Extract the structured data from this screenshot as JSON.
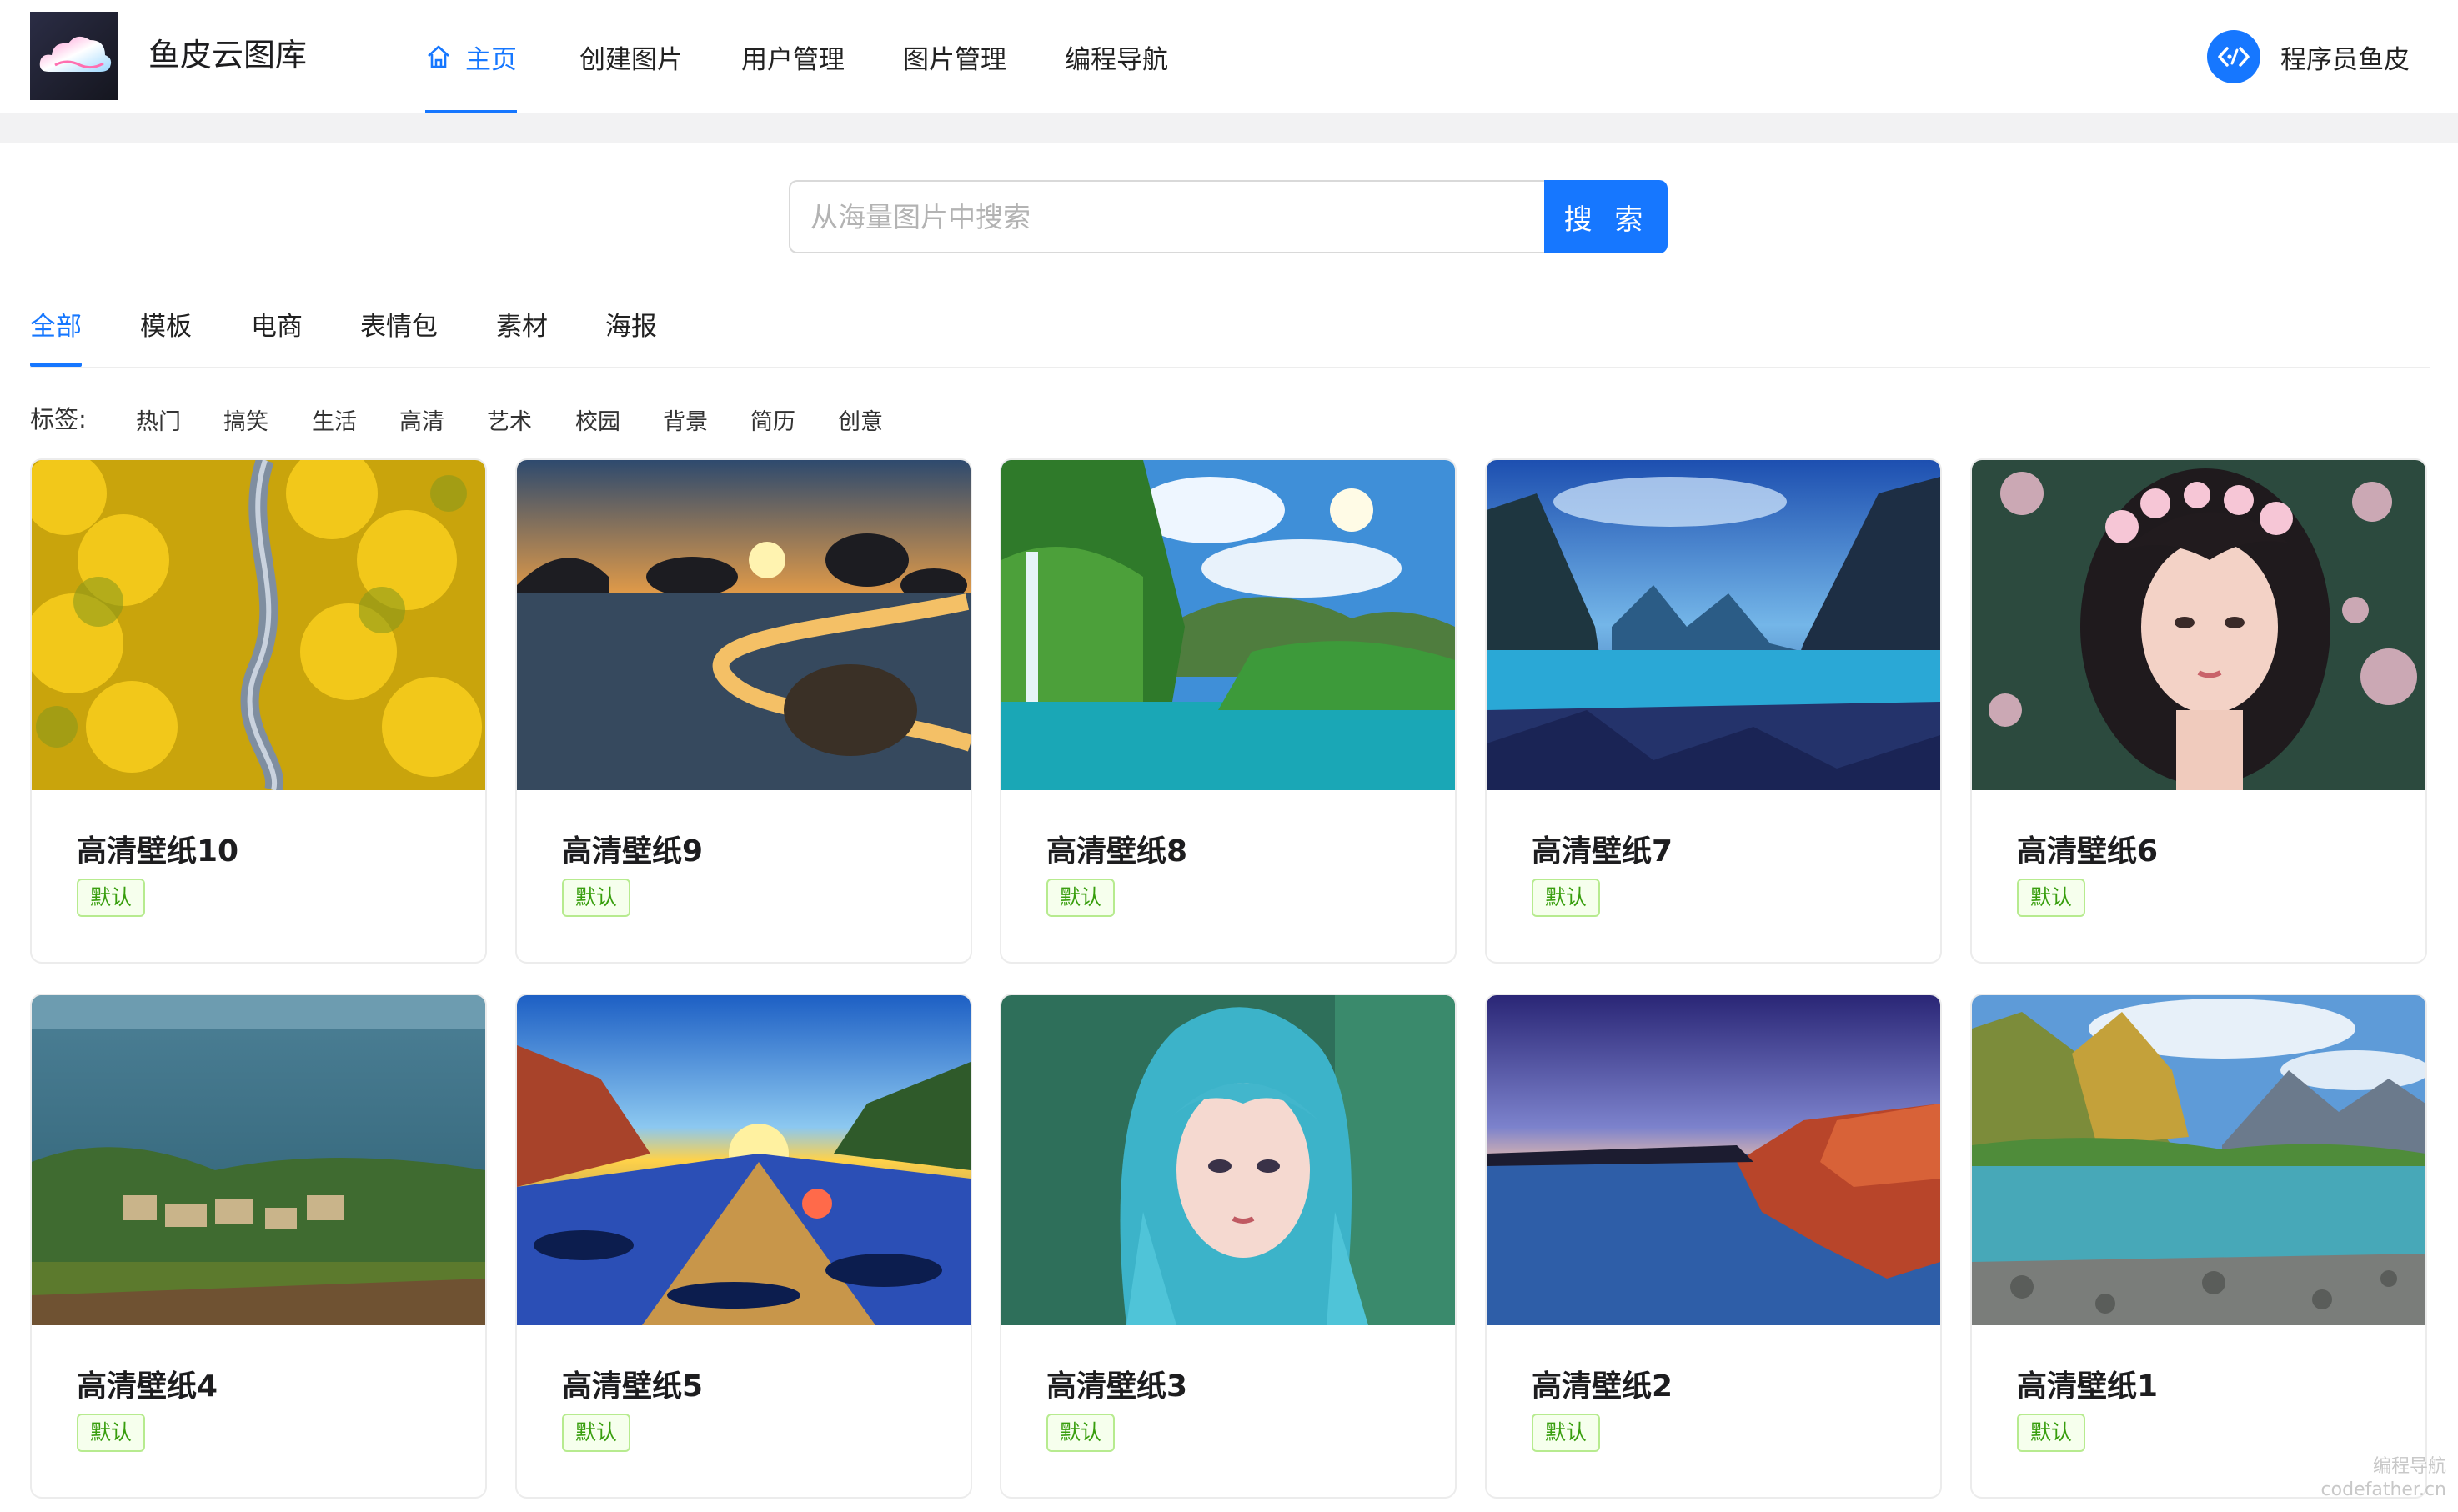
{
  "app": {
    "name": "鱼皮云图库"
  },
  "nav": {
    "items": [
      {
        "label": "主页",
        "active": true
      },
      {
        "label": "创建图片",
        "active": false
      },
      {
        "label": "用户管理",
        "active": false
      },
      {
        "label": "图片管理",
        "active": false
      },
      {
        "label": "编程导航",
        "active": false
      }
    ]
  },
  "user": {
    "name": "程序员鱼皮"
  },
  "search": {
    "placeholder": "从海量图片中搜索",
    "value": "",
    "button_label": "搜 索"
  },
  "categories": {
    "items": [
      {
        "label": "全部",
        "active": true
      },
      {
        "label": "模板",
        "active": false
      },
      {
        "label": "电商",
        "active": false
      },
      {
        "label": "表情包",
        "active": false
      },
      {
        "label": "素材",
        "active": false
      },
      {
        "label": "海报",
        "active": false
      }
    ]
  },
  "tags": {
    "label": "标签:",
    "items": [
      "热门",
      "搞笑",
      "生活",
      "高清",
      "艺术",
      "校园",
      "背景",
      "简历",
      "创意"
    ]
  },
  "pictures": [
    {
      "title": "高清壁纸10",
      "tag": "默认",
      "scene": "aerial-forest"
    },
    {
      "title": "高清壁纸9",
      "tag": "默认",
      "scene": "sunset-beach"
    },
    {
      "title": "高清壁纸8",
      "tag": "默认",
      "scene": "waterfall-lake"
    },
    {
      "title": "高清壁纸7",
      "tag": "默认",
      "scene": "blue-fjord"
    },
    {
      "title": "高清壁纸6",
      "tag": "默认",
      "scene": "flower-girl"
    },
    {
      "title": "高清壁纸4",
      "tag": "默认",
      "scene": "coastal-village"
    },
    {
      "title": "高清壁纸5",
      "tag": "默认",
      "scene": "sunrise-river"
    },
    {
      "title": "高清壁纸3",
      "tag": "默认",
      "scene": "blue-hair-girl"
    },
    {
      "title": "高清壁纸2",
      "tag": "默认",
      "scene": "red-cliff-sea"
    },
    {
      "title": "高清壁纸1",
      "tag": "默认",
      "scene": "mountain-lake"
    }
  ],
  "watermark": {
    "line1": "编程导航",
    "line2": "codefather.cn"
  },
  "colors": {
    "primary": "#1677ff",
    "tag_green": "#389e0d"
  }
}
